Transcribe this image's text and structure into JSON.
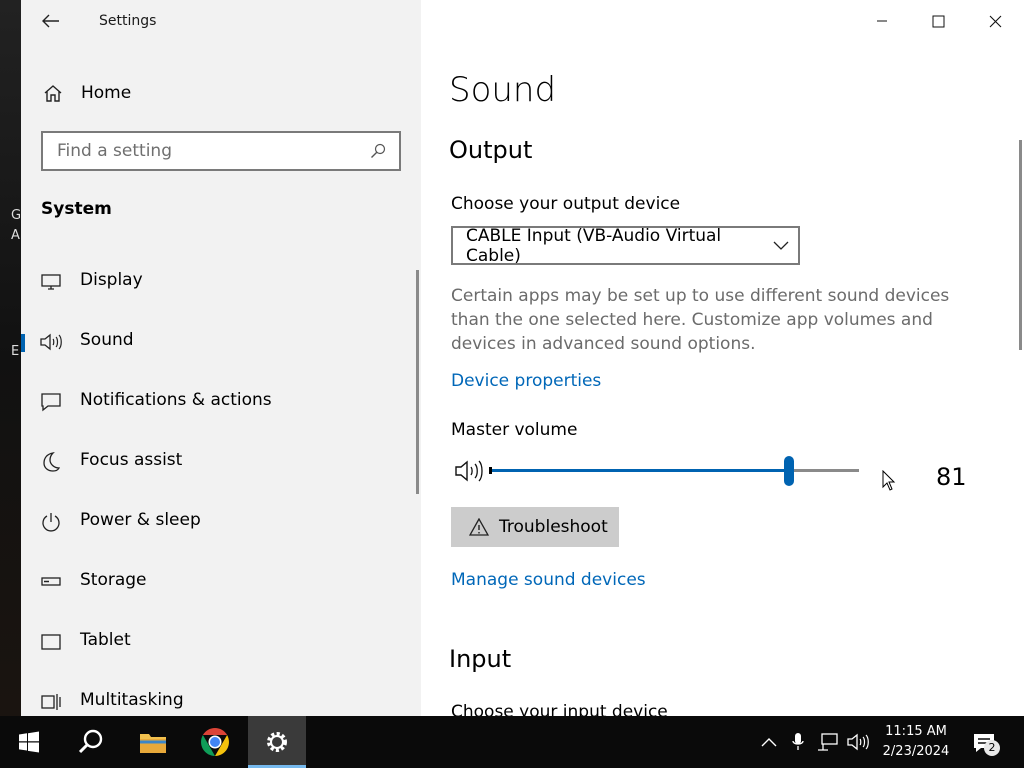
{
  "desktop": {
    "glyphs": [
      "G",
      "A",
      "E"
    ]
  },
  "window": {
    "app_title": "Settings",
    "controls": {
      "minimize": "minimize",
      "maximize": "maximize",
      "close": "close"
    }
  },
  "sidebar": {
    "home_label": "Home",
    "search_placeholder": "Find a setting",
    "section_title": "System",
    "items": [
      {
        "label": "Display",
        "icon": "display-icon",
        "active": false
      },
      {
        "label": "Sound",
        "icon": "speaker-icon",
        "active": true
      },
      {
        "label": "Notifications & actions",
        "icon": "notification-icon",
        "active": false
      },
      {
        "label": "Focus assist",
        "icon": "moon-icon",
        "active": false
      },
      {
        "label": "Power & sleep",
        "icon": "power-icon",
        "active": false
      },
      {
        "label": "Storage",
        "icon": "storage-icon",
        "active": false
      },
      {
        "label": "Tablet",
        "icon": "tablet-icon",
        "active": false
      },
      {
        "label": "Multitasking",
        "icon": "multitasking-icon",
        "active": false
      }
    ]
  },
  "main": {
    "title": "Sound",
    "output": {
      "heading": "Output",
      "choose_label": "Choose your output device",
      "selected_device": "CABLE Input (VB-Audio Virtual Cable)",
      "description": "Certain apps may be set up to use different sound devices than the one selected here. Customize app volumes and devices in advanced sound options.",
      "device_properties_link": "Device properties",
      "master_volume_label": "Master volume",
      "volume_value": "81",
      "troubleshoot_label": "Troubleshoot",
      "manage_devices_link": "Manage sound devices"
    },
    "input": {
      "heading": "Input",
      "choose_label": "Choose your input device"
    }
  },
  "taskbar": {
    "apps": [
      "start",
      "search",
      "file-explorer",
      "chrome",
      "settings"
    ],
    "active_app": "settings",
    "time": "11:15 AM",
    "date": "2/23/2024",
    "notification_count": "2"
  },
  "colors": {
    "accent": "#0063b1",
    "link": "#0067b8",
    "sidebar_bg": "#f2f2f2"
  }
}
